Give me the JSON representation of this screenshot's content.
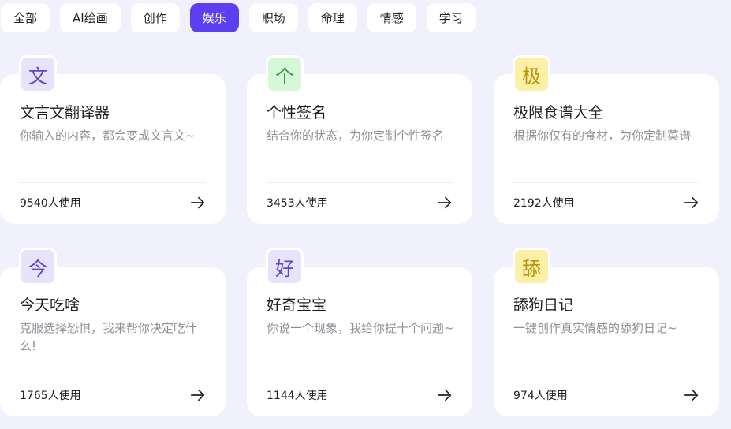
{
  "tabs": [
    {
      "label": "全部",
      "active": false
    },
    {
      "label": "AI绘画",
      "active": false
    },
    {
      "label": "创作",
      "active": false
    },
    {
      "label": "娱乐",
      "active": true
    },
    {
      "label": "职场",
      "active": false
    },
    {
      "label": "命理",
      "active": false
    },
    {
      "label": "情感",
      "active": false
    },
    {
      "label": "学习",
      "active": false
    }
  ],
  "cards": [
    {
      "badge": "文",
      "badge_bg": "#e6e3fb",
      "badge_color": "#5a47c8",
      "title": "文言文翻译器",
      "desc": "你输入的内容，都会变成文言文~",
      "usage": "9540人使用"
    },
    {
      "badge": "个",
      "badge_bg": "#d7f7d9",
      "badge_color": "#2f9b3c",
      "title": "个性签名",
      "desc": "结合你的状态，为你定制个性签名",
      "usage": "3453人使用"
    },
    {
      "badge": "极",
      "badge_bg": "#fbf0a6",
      "badge_color": "#b5950e",
      "title": "极限食谱大全",
      "desc": "根据你仅有的食材，为你定制菜谱",
      "usage": "2192人使用"
    },
    {
      "badge": "今",
      "badge_bg": "#e6e3fb",
      "badge_color": "#5a47c8",
      "title": "今天吃啥",
      "desc": "克服选择恐惧，我来帮你决定吃什么!",
      "usage": "1765人使用"
    },
    {
      "badge": "好",
      "badge_bg": "#e6e3fb",
      "badge_color": "#5a47c8",
      "title": "好奇宝宝",
      "desc": "你说一个现象，我给你提十个问题~",
      "usage": "1144人使用"
    },
    {
      "badge": "舔",
      "badge_bg": "#fbf0a6",
      "badge_color": "#b5950e",
      "title": "舔狗日记",
      "desc": "一键创作真实情感的舔狗日记~",
      "usage": "974人使用"
    }
  ],
  "icons": {
    "arrow": "arrow-right-icon"
  }
}
